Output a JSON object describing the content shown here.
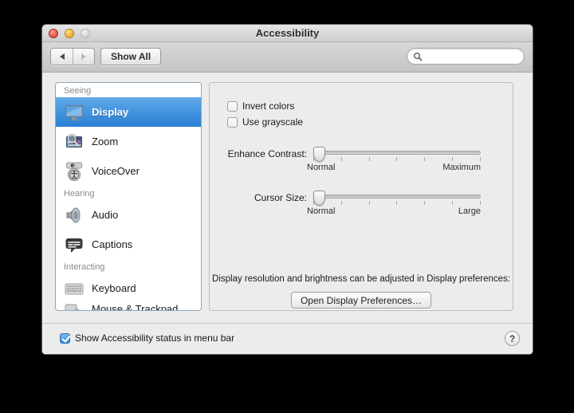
{
  "window": {
    "title": "Accessibility",
    "traffic_lights": [
      "close-button",
      "minimize-button",
      "zoom-button"
    ]
  },
  "toolbar": {
    "back_label": "◀",
    "forward_label": "▶",
    "show_all_label": "Show All",
    "search_placeholder": "",
    "search_value": "",
    "search_icon": "search-icon"
  },
  "sidebar": {
    "groups": [
      {
        "header": "Seeing",
        "items": [
          {
            "label": "Display",
            "icon": "display-monitor-icon",
            "selected": true
          },
          {
            "label": "Zoom",
            "icon": "zoom-magnifier-icon",
            "selected": false
          },
          {
            "label": "VoiceOver",
            "icon": "voiceover-icon",
            "selected": false
          }
        ]
      },
      {
        "header": "Hearing",
        "items": [
          {
            "label": "Audio",
            "icon": "speaker-icon",
            "selected": false
          },
          {
            "label": "Captions",
            "icon": "captions-icon",
            "selected": false
          }
        ]
      },
      {
        "header": "Interacting",
        "items": [
          {
            "label": "Keyboard",
            "icon": "keyboard-icon",
            "selected": false
          },
          {
            "label": "Mouse & Trackpad",
            "icon": "mouse-icon",
            "selected": false
          }
        ]
      }
    ]
  },
  "content": {
    "checkboxes": [
      {
        "label": "Invert colors",
        "checked": false
      },
      {
        "label": "Use grayscale",
        "checked": false
      }
    ],
    "sliders": [
      {
        "label": "Enhance Contrast:",
        "min_label": "Normal",
        "max_label": "Maximum",
        "value_percent": 0,
        "tick_count": 7
      },
      {
        "label": "Cursor Size:",
        "min_label": "Normal",
        "max_label": "Large",
        "value_percent": 0,
        "tick_count": 7
      }
    ],
    "note": "Display resolution and brightness can be adjusted in Display preferences:",
    "open_display_button": "Open Display Preferences…"
  },
  "footer": {
    "status_checkbox_label": "Show Accessibility status in menu bar",
    "status_checked": true,
    "help_label": "?"
  },
  "colors": {
    "selection_blue": "#2a7fd4",
    "window_bg": "#ececec",
    "desktop": "#000000"
  }
}
